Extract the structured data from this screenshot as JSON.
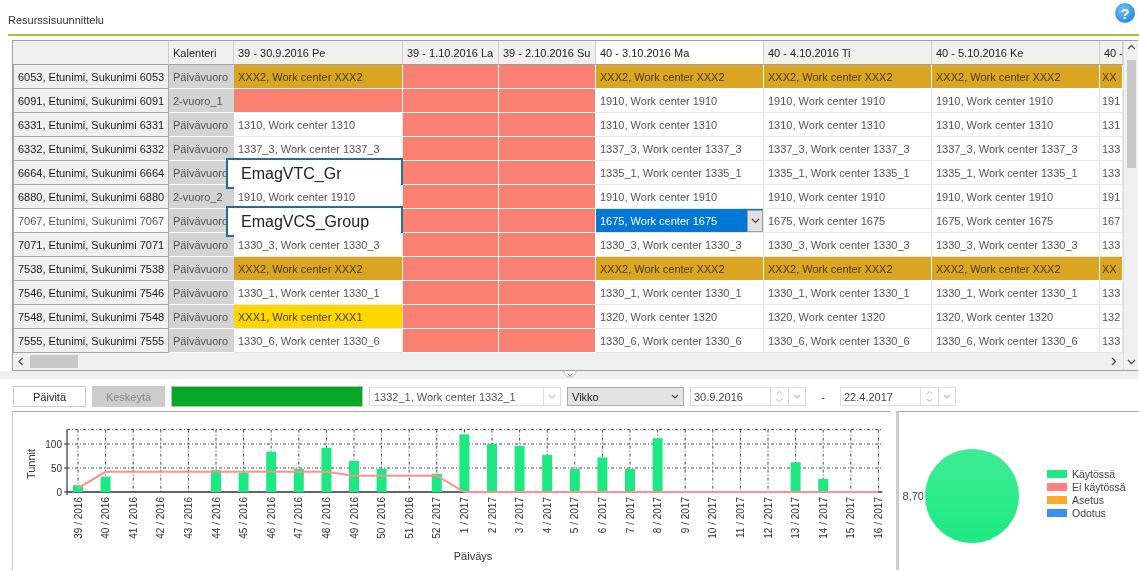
{
  "window": {
    "title": "Resurssisuunnittelu",
    "help": "?"
  },
  "grid": {
    "calendar_header": {
      "label": "Kalenteri"
    },
    "columns": [
      {
        "label": "39 - 30.9.2016 Pe",
        "selected": false
      },
      {
        "label": "39 - 1.10.2016 La",
        "selected": false
      },
      {
        "label": "39 - 2.10.2016 Su",
        "selected": false
      },
      {
        "label": "40 - 3.10.2016 Ma",
        "selected": true
      },
      {
        "label": "40 - 4.10.2016 Ti",
        "selected": false
      },
      {
        "label": "40 - 5.10.2016 Ke",
        "selected": false
      },
      {
        "label": "40 -",
        "selected": false
      }
    ],
    "rows": [
      {
        "resource": "6053, Etunimi, Sukunimi 6053",
        "calendar": "Päivävuoro",
        "selected": false,
        "cells": [
          {
            "kind": "conflict",
            "text": "XXX2, Work center XXX2"
          },
          {
            "kind": "off"
          },
          {
            "kind": "off"
          },
          {
            "kind": "conflict",
            "text": "XXX2, Work center XXX2"
          },
          {
            "kind": "conflict",
            "text": "XXX2, Work center XXX2"
          },
          {
            "kind": "conflict",
            "text": "XXX2, Work center XXX2"
          },
          {
            "kind": "conflict",
            "text": "XX"
          }
        ]
      },
      {
        "resource": "6091, Etunimi, Sukunimi 6091",
        "calendar": "2-vuoro_1",
        "selected": false,
        "cells": [
          {
            "kind": "off"
          },
          {
            "kind": "off"
          },
          {
            "kind": "off"
          },
          {
            "kind": "plain",
            "text": "1910, Work center 1910"
          },
          {
            "kind": "plain",
            "text": "1910, Work center 1910"
          },
          {
            "kind": "plain",
            "text": "1910, Work center 1910"
          },
          {
            "kind": "plain",
            "text": "191"
          }
        ]
      },
      {
        "resource": "6331, Etunimi, Sukunimi 6331",
        "calendar": "Päivävuoro",
        "selected": false,
        "cells": [
          {
            "kind": "plain",
            "text": "1310, Work center 1310"
          },
          {
            "kind": "off"
          },
          {
            "kind": "off"
          },
          {
            "kind": "plain",
            "text": "1310, Work center 1310"
          },
          {
            "kind": "plain",
            "text": "1310, Work center 1310"
          },
          {
            "kind": "plain",
            "text": "1310, Work center 1310"
          },
          {
            "kind": "plain",
            "text": "131"
          }
        ]
      },
      {
        "resource": "6332, Etunimi, Sukunimi 6332",
        "calendar": "Päivävuoro",
        "selected": false,
        "cells": [
          {
            "kind": "plain",
            "text": "1337_3, Work center 1337_3"
          },
          {
            "kind": "off"
          },
          {
            "kind": "off"
          },
          {
            "kind": "plain",
            "text": "1337_3, Work center 1337_3"
          },
          {
            "kind": "plain",
            "text": "1337_3, Work center 1337_3"
          },
          {
            "kind": "plain",
            "text": "1337_3, Work center 1337_3"
          },
          {
            "kind": "plain",
            "text": "133"
          }
        ]
      },
      {
        "resource": "6664, Etunimi, Sukunimi 6664",
        "calendar": "Päivävuoro",
        "selected": false,
        "cells": [
          {
            "kind": "covered",
            "popup": "EmagVTC_Gr"
          },
          {
            "kind": "off"
          },
          {
            "kind": "off"
          },
          {
            "kind": "plain",
            "text": "1335_1, Work center 1335_1"
          },
          {
            "kind": "plain",
            "text": "1335_1, Work center 1335_1"
          },
          {
            "kind": "plain",
            "text": "1335_1, Work center 1335_1"
          },
          {
            "kind": "plain",
            "text": "133"
          }
        ]
      },
      {
        "resource": "6880, Etunimi, Sukunimi 6880",
        "calendar": "2-vuoro_2",
        "selected": false,
        "cells": [
          {
            "kind": "plain",
            "text": "1910, Work center 1910"
          },
          {
            "kind": "off"
          },
          {
            "kind": "off"
          },
          {
            "kind": "plain",
            "text": "1910, Work center 1910"
          },
          {
            "kind": "plain",
            "text": "1910, Work center 1910"
          },
          {
            "kind": "plain",
            "text": "1910, Work center 1910"
          },
          {
            "kind": "plain",
            "text": "191"
          }
        ]
      },
      {
        "resource": "7067, Etunimi, Sukunimi 7067",
        "calendar": "Päivävuoro",
        "selected": true,
        "cells": [
          {
            "kind": "covered",
            "popup": "EmagVCS_Group"
          },
          {
            "kind": "off"
          },
          {
            "kind": "off"
          },
          {
            "kind": "editing",
            "text": "1675, Work center 1675"
          },
          {
            "kind": "plain",
            "text": "1675, Work center 1675"
          },
          {
            "kind": "plain",
            "text": "1675, Work center 1675"
          },
          {
            "kind": "plain",
            "text": "167"
          }
        ]
      },
      {
        "resource": "7071, Etunimi, Sukunimi 7071",
        "calendar": "Päivävuoro",
        "selected": false,
        "cells": [
          {
            "kind": "plain",
            "text": "1330_3, Work center 1330_3"
          },
          {
            "kind": "off"
          },
          {
            "kind": "off"
          },
          {
            "kind": "plain",
            "text": "1330_3, Work center 1330_3"
          },
          {
            "kind": "plain",
            "text": "1330_3, Work center 1330_3"
          },
          {
            "kind": "plain",
            "text": "1330_3, Work center 1330_3"
          },
          {
            "kind": "plain",
            "text": "133"
          }
        ]
      },
      {
        "resource": "7538, Etunimi, Sukunimi 7538",
        "calendar": "Päivävuoro",
        "selected": false,
        "cells": [
          {
            "kind": "conflict",
            "text": "XXX2, Work center XXX2"
          },
          {
            "kind": "off"
          },
          {
            "kind": "off"
          },
          {
            "kind": "conflict",
            "text": "XXX2, Work center XXX2"
          },
          {
            "kind": "conflict",
            "text": "XXX2, Work center XXX2"
          },
          {
            "kind": "conflict",
            "text": "XXX2, Work center XXX2"
          },
          {
            "kind": "conflict",
            "text": "XX"
          }
        ]
      },
      {
        "resource": "7546, Etunimi, Sukunimi 7546",
        "calendar": "Päivävuoro",
        "selected": false,
        "cells": [
          {
            "kind": "plain",
            "text": "1330_1, Work center 1330_1"
          },
          {
            "kind": "off"
          },
          {
            "kind": "off"
          },
          {
            "kind": "plain",
            "text": "1330_1, Work center 1330_1"
          },
          {
            "kind": "plain",
            "text": "1330_1, Work center 1330_1"
          },
          {
            "kind": "plain",
            "text": "1330_1, Work center 1330_1"
          },
          {
            "kind": "plain",
            "text": "133"
          }
        ]
      },
      {
        "resource": "7548, Etunimi, Sukunimi 7548",
        "calendar": "Päivävuoro",
        "selected": false,
        "cells": [
          {
            "kind": "warning",
            "text": "XXX1, Work center XXX1"
          },
          {
            "kind": "off"
          },
          {
            "kind": "off"
          },
          {
            "kind": "plain",
            "text": "1320, Work center 1320"
          },
          {
            "kind": "plain",
            "text": "1320, Work center 1320"
          },
          {
            "kind": "plain",
            "text": "1320, Work center 1320"
          },
          {
            "kind": "plain",
            "text": "132"
          }
        ]
      },
      {
        "resource": "7555, Etunimi, Sukunimi 7555",
        "calendar": "Päivävuoro",
        "selected": false,
        "cells": [
          {
            "kind": "plain",
            "text": "1330_6, Work center 1330_6"
          },
          {
            "kind": "off"
          },
          {
            "kind": "off"
          },
          {
            "kind": "plain",
            "text": "1330_6, Work center 1330_6"
          },
          {
            "kind": "plain",
            "text": "1330_6, Work center 1330_6"
          },
          {
            "kind": "plain",
            "text": "1330_6, Work center 1330_6"
          },
          {
            "kind": "plain",
            "text": "133"
          }
        ]
      }
    ]
  },
  "toolbar": {
    "buttons": [
      {
        "label": "Päivitä",
        "disabled": false
      },
      {
        "label": "Keskeytä",
        "disabled": true
      }
    ],
    "progress": {
      "level": 1
    },
    "work_center": {
      "value": "1332_1, Work center 1332_1"
    },
    "period": {
      "value": "Vikko"
    },
    "date_from": {
      "value": "30.9.2016"
    },
    "separator": "-",
    "date_to": {
      "value": "22.4.2017"
    }
  },
  "bar_chart": {
    "chart_data": {
      "type": "bar",
      "grid": true,
      "xlabel": "Päiväys",
      "ylabel": "Tunnit",
      "ylim": [
        0,
        130
      ],
      "yticks": [
        0,
        50,
        100
      ],
      "categories": [
        "39 / 2016",
        "40 / 2016",
        "41 / 2016",
        "42 / 2016",
        "43 / 2016",
        "44 / 2016",
        "45 / 2016",
        "46 / 2016",
        "47 / 2016",
        "48 / 2016",
        "49 / 2016",
        "50 / 2016",
        "51 / 2016",
        "52 / 2017",
        "1 / 2017",
        "2 / 2017",
        "3 / 2017",
        "4 / 2017",
        "5 / 2017",
        "6 / 2017",
        "7 / 2017",
        "8 / 2017",
        "9 / 2017",
        "10 / 2017",
        "11 / 2017",
        "12 / 2017",
        "13 / 2017",
        "14 / 2017",
        "15 / 2017",
        "16 / 2017"
      ],
      "series": [
        {
          "type": "bar",
          "color": "#1de982",
          "values": [
            14,
            32,
            0,
            0,
            0,
            46,
            40,
            84,
            48,
            92,
            65,
            48,
            0,
            38,
            120,
            100,
            96,
            77,
            48,
            72,
            48,
            112,
            0,
            0,
            0,
            0,
            62,
            27,
            0,
            0
          ]
        },
        {
          "type": "line",
          "color": "#ff9090",
          "values": [
            8,
            42,
            42,
            42,
            42,
            42,
            42,
            42,
            42,
            42,
            34,
            34,
            34,
            34,
            0,
            0,
            0,
            0,
            0,
            0,
            0,
            0,
            0,
            0,
            0,
            0,
            0,
            0,
            0,
            0
          ]
        }
      ]
    }
  },
  "pie_chart": {
    "chart_data": {
      "type": "pie",
      "categories": [
        "Käytössä",
        "Ei käytössä",
        "Asetus",
        "Odotus"
      ],
      "colors": [
        "#1de982",
        "#ff8080",
        "#ffa726",
        "#3d8ef0"
      ],
      "values": [
        8.7,
        0,
        0,
        0
      ],
      "value_labels": [
        "8,70",
        null,
        null,
        null
      ]
    }
  }
}
